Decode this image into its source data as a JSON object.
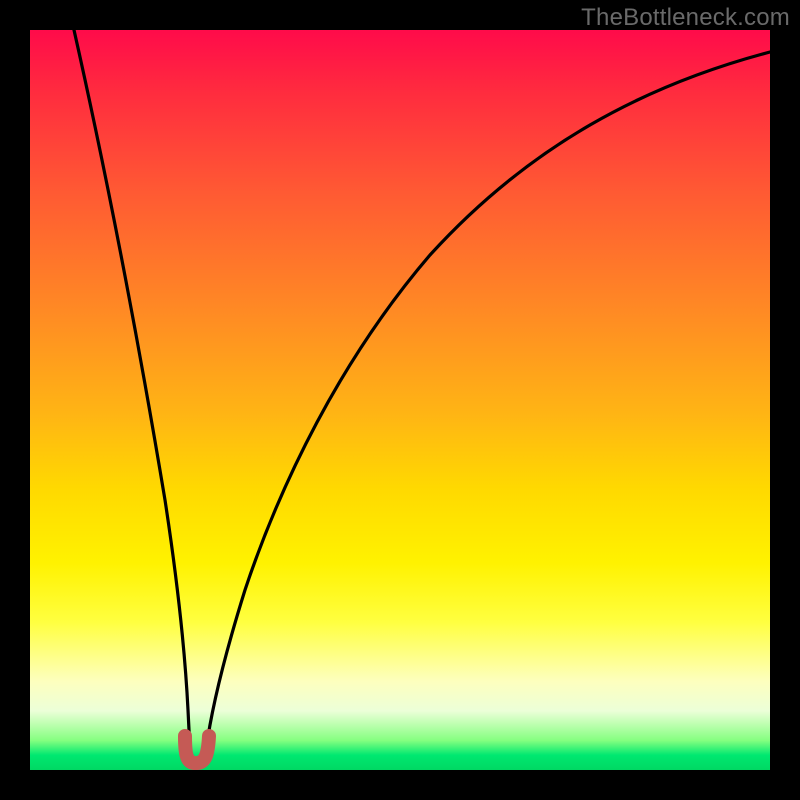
{
  "watermark": "TheBottleneck.com",
  "chart_data": {
    "type": "line",
    "title": "",
    "xlabel": "",
    "ylabel": "",
    "xlim": [
      0,
      100
    ],
    "ylim": [
      0,
      100
    ],
    "grid": false,
    "series": [
      {
        "name": "bottleneck-curve",
        "x": [
          6,
          10,
          14,
          17,
          19.5,
          21,
          22.5,
          24,
          26,
          30,
          36,
          44,
          53,
          62,
          72,
          83,
          94,
          100
        ],
        "values": [
          100,
          78,
          56,
          37,
          17,
          4,
          3,
          4,
          13,
          31,
          48,
          62,
          73,
          81,
          87.5,
          92.5,
          96,
          97.5
        ]
      }
    ],
    "notch": {
      "x_center": 21.7,
      "y_baseline": 2.5,
      "color": "#c55a55",
      "width": 3.5,
      "depth": 3
    },
    "background_gradient": {
      "top": "#ff0b4a",
      "mid": "#ffd900",
      "bottom": "#00d863"
    }
  }
}
